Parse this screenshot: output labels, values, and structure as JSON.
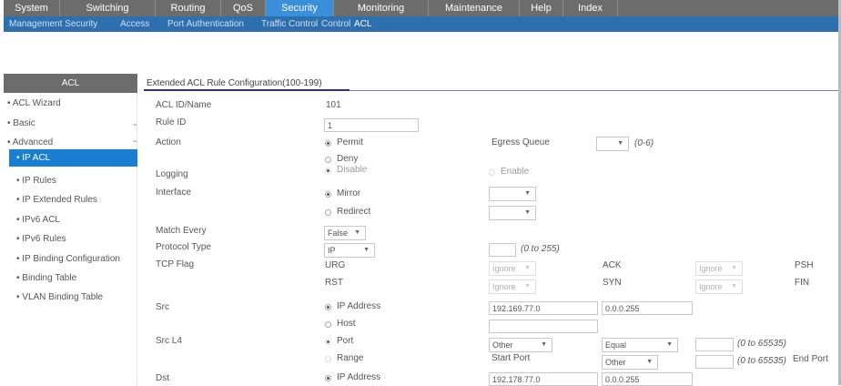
{
  "topnav": [
    "System",
    "Switching",
    "Routing",
    "QoS",
    "Security",
    "Monitoring",
    "Maintenance",
    "Help",
    "Index"
  ],
  "subnav": [
    "Management Security",
    "Access",
    "Port Authentication",
    "Traffic Control",
    "Control",
    "ACL"
  ],
  "sidebar": {
    "header": "ACL",
    "items": [
      "ACL Wizard",
      "Basic",
      "Advanced",
      "IP ACL",
      "IP Rules",
      "IP Extended Rules",
      "IPv6 ACL",
      "IPv6 Rules",
      "IP Binding Configuration",
      "Binding Table",
      "VLAN Binding Table"
    ]
  },
  "page_title": "Extended ACL Rule Configuration(100-199)",
  "form": {
    "acl_id_label": "ACL ID/Name",
    "acl_id_value": "101",
    "rule_id_label": "Rule ID",
    "rule_id_value": "1",
    "action_label": "Action",
    "permit": "Permit",
    "deny": "Deny",
    "egress_queue_label": "Egress Queue",
    "egress_queue_range": "(0-6)",
    "logging_label": "Logging",
    "disable": "Disable",
    "enable": "Enable",
    "interface_label": "Interface",
    "mirror": "Mirror",
    "redirect": "Redirect",
    "match_every_label": "Match Every",
    "match_every_value": "False",
    "protocol_type_label": "Protocol Type",
    "protocol_type_value": "IP",
    "protocol_range": "(0 to 255)",
    "tcp_flag_label": "TCP Flag",
    "urg": "URG",
    "rst": "RST",
    "ack": "ACK",
    "syn": "SYN",
    "psh": "PSH",
    "fin": "FIN",
    "ignore": "Ignore",
    "src_label": "Src",
    "ip_address": "IP Address",
    "host": "Host",
    "src_ip": "192.169.77.0",
    "src_mask": "0.0.0.255",
    "src_l4_label": "Src L4",
    "port": "Port",
    "range": "Range",
    "other": "Other",
    "equal": "Equal",
    "port_range": "(0 to 65535)",
    "start_port": "Start Port",
    "end_port": "End Port",
    "dst_label": "Dst",
    "dst_ip": "192.178.77.0",
    "dst_mask": "0.0.0.255"
  }
}
